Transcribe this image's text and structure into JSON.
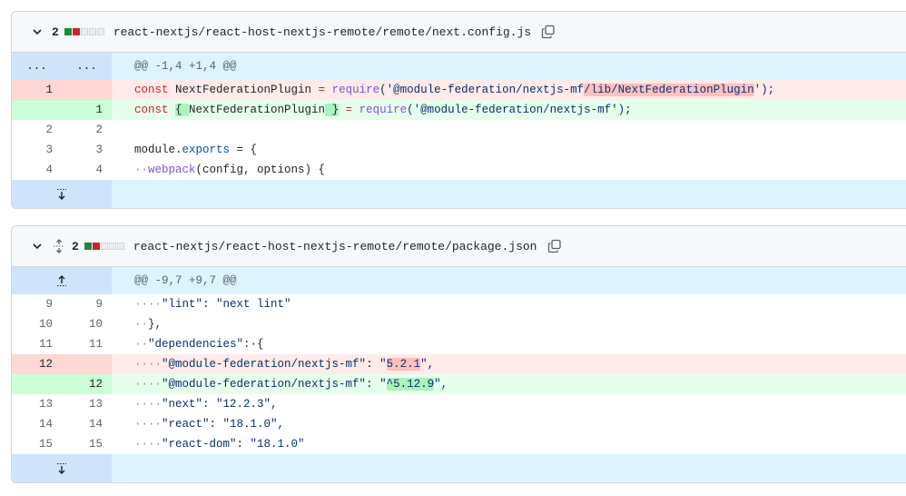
{
  "files": [
    {
      "count": "2",
      "path": "react-nextjs/react-host-nextjs-remote/remote/next.config.js",
      "hunk_header": "@@ -1,4 +1,4 @@",
      "hunk_left": "...",
      "hunk_right": "..."
    },
    {
      "count": "2",
      "path": "react-nextjs/react-host-nextjs-remote/remote/package.json",
      "hunk_header": "@@ -9,7 +9,7 @@"
    }
  ],
  "f1": {
    "del1": {
      "old": "1",
      "a": "const ",
      "b": "NextFederationPlugin",
      "c": " = ",
      "d": "require",
      "e": "('@module-federation/nextjs-mf",
      "f": "/lib/NextFederationPlugin",
      "g": "');"
    },
    "add1": {
      "new": "1",
      "a": "const ",
      "b": "{ ",
      "c": "NextFederationPlugin",
      "d": " }",
      "e": " = ",
      "f": "require",
      "g": "('@module-federation/nextjs-mf');"
    },
    "ctx2": {
      "old": "2",
      "new": "2",
      "text": ""
    },
    "ctx3": {
      "old": "3",
      "new": "3",
      "a": "module.",
      "b": "exports",
      "c": " = {"
    },
    "ctx4": {
      "old": "4",
      "new": "4",
      "ws": "··",
      "a": "webpack",
      "b": "(config, options) {"
    }
  },
  "f2": {
    "r9": {
      "old": "9",
      "new": "9",
      "ws": "····",
      "a": "\"lint\"",
      "b": ": ",
      "c": "\"next lint\""
    },
    "r10": {
      "old": "10",
      "new": "10",
      "ws": "··",
      "a": "},"
    },
    "r11": {
      "old": "11",
      "new": "11",
      "ws": "··",
      "a": "\"dependencies\"",
      "b": ":·{"
    },
    "del12": {
      "old": "12",
      "ws": "····",
      "a": "\"@module-federation/nextjs-mf\"",
      "b": ": ",
      "c": "\"",
      "d": "5.2.1",
      "e": "\","
    },
    "add12": {
      "new": "12",
      "ws": "····",
      "a": "\"@module-federation/nextjs-mf\"",
      "b": ": ",
      "c": "\"",
      "d": "^5.12.9",
      "e": "\","
    },
    "r13": {
      "old": "13",
      "new": "13",
      "ws": "····",
      "a": "\"next\"",
      "b": ": ",
      "c": "\"12.2.3\","
    },
    "r14": {
      "old": "14",
      "new": "14",
      "ws": "····",
      "a": "\"react\"",
      "b": ": ",
      "c": "\"18.1.0\","
    },
    "r15": {
      "old": "15",
      "new": "15",
      "ws": "····",
      "a": "\"react-dom\"",
      "b": ": ",
      "c": "\"18.1.0\""
    }
  },
  "icons": [
    "chevron-down-icon",
    "copy-icon",
    "unfold-icon",
    "fold-up-icon",
    "fold-down-icon"
  ],
  "colors": {
    "added": "#1f883d",
    "deleted": "#cf222e",
    "hunk_bg": "#ddf4ff",
    "del_bg": "#ffebe9",
    "add_bg": "#e6ffec"
  }
}
